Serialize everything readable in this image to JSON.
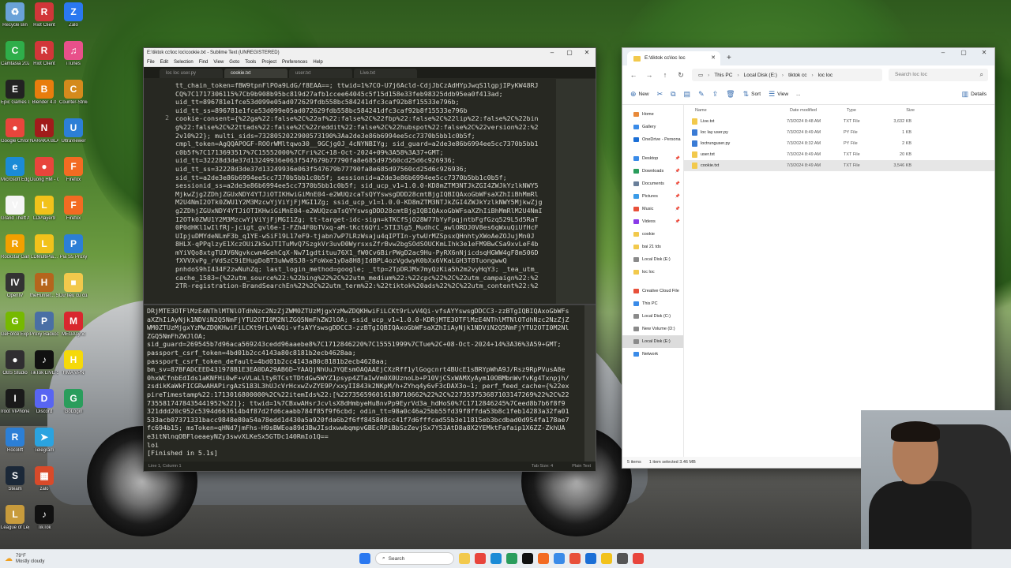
{
  "desktop_icons": [
    {
      "label": "Recycle Bin",
      "color": "#6aa2d8",
      "glyph": "♻"
    },
    {
      "label": "Riot Client",
      "color": "#d13639",
      "glyph": "R"
    },
    {
      "label": "Zalo",
      "color": "#2a78f0",
      "glyph": "Z"
    },
    {
      "label": "Camtasia 2021",
      "color": "#2fae4a",
      "glyph": "C"
    },
    {
      "label": "Riot Client",
      "color": "#d13639",
      "glyph": "R"
    },
    {
      "label": "iTunes",
      "color": "#e8508a",
      "glyph": "♫"
    },
    {
      "label": "Epic Games Launcher",
      "color": "#222222",
      "glyph": "E"
    },
    {
      "label": "Blender 4.0",
      "color": "#e87d0d",
      "glyph": "B"
    },
    {
      "label": "Counter-Strike 2",
      "color": "#d48a1c",
      "glyph": "C"
    },
    {
      "label": "Google Chrome",
      "color": "#e8453c",
      "glyph": "●"
    },
    {
      "label": "NARAKA BLADEPOINT",
      "color": "#a11b1b",
      "glyph": "N"
    },
    {
      "label": "UltraViewer",
      "color": "#2c7fd6",
      "glyph": "U"
    },
    {
      "label": "Microsoft Edge",
      "color": "#1b8bd6",
      "glyph": "e"
    },
    {
      "label": "Duong HM - Chrome",
      "color": "#e8453c",
      "glyph": "●"
    },
    {
      "label": "Firefox",
      "color": "#f36b22",
      "glyph": "F"
    },
    {
      "label": "Grand Theft Auto V",
      "color": "#f5f5f5",
      "glyph": "V"
    },
    {
      "label": "LDPlayer9",
      "color": "#f2c21b",
      "glyph": "L"
    },
    {
      "label": "Firefox",
      "color": "#f36b22",
      "glyph": "F"
    },
    {
      "label": "Rockstar Games ...",
      "color": "#f2a000",
      "glyph": "R"
    },
    {
      "label": "LDMultiPla...",
      "color": "#f2c21b",
      "glyph": "L"
    },
    {
      "label": "Pia S5 Proxy",
      "color": "#2c7fd6",
      "glyph": "P"
    },
    {
      "label": "OpenIV",
      "color": "#333333",
      "glyph": "IV"
    },
    {
      "label": "theHunter... Shortcut",
      "color": "#b5651d",
      "glyph": "H"
    },
    {
      "label": "Dữ liệu cũ của Firefox",
      "color": "#f2c94c",
      "glyph": "■"
    },
    {
      "label": "GeForce Experience",
      "color": "#76b900",
      "glyph": "G"
    },
    {
      "label": "Proxy Backconne...",
      "color": "#4a6fa5",
      "glyph": "P"
    },
    {
      "label": "MEGAsync",
      "color": "#d9272e",
      "glyph": "M"
    },
    {
      "label": "OBS Studio",
      "color": "#302e31",
      "glyph": "●"
    },
    {
      "label": "TikTok LIVE Studio",
      "color": "#111111",
      "glyph": "♪"
    },
    {
      "label": "HMA VPN",
      "color": "#f5d90a",
      "glyph": "H"
    },
    {
      "label": "Iroot VIPhone",
      "color": "#1a1a1a",
      "glyph": "I"
    },
    {
      "label": "Discord",
      "color": "#5865f2",
      "glyph": "D"
    },
    {
      "label": "GoLogin",
      "color": "#2a9d5c",
      "glyph": "G"
    },
    {
      "label": "Rocolift",
      "color": "#2c7fd6",
      "glyph": "R"
    },
    {
      "label": "Telegram",
      "color": "#2aa3e0",
      "glyph": "➤"
    },
    {
      "label": "",
      "color": "",
      "glyph": ""
    },
    {
      "label": "Steam",
      "color": "#1b2838",
      "glyph": "S"
    },
    {
      "label": "zalo",
      "color": "#d84a2a",
      "glyph": "▦"
    },
    {
      "label": "",
      "color": "",
      "glyph": ""
    },
    {
      "label": "League of Legends",
      "color": "#c89b3c",
      "glyph": "L"
    },
    {
      "label": "TikTok",
      "color": "#111111",
      "glyph": "♪"
    }
  ],
  "sublime": {
    "title": "E:\\tiktok cc\\loc loc\\cookie.txt - Sublime Text (UNREGISTERED)",
    "menu": [
      "File",
      "Edit",
      "Selection",
      "Find",
      "View",
      "Goto",
      "Tools",
      "Project",
      "Preferences",
      "Help"
    ],
    "tabs": [
      {
        "label": "loc loc user.py",
        "active": false
      },
      {
        "label": "cookie.txt",
        "active": true
      },
      {
        "label": "user.txt",
        "active": false
      },
      {
        "label": "Live.txt",
        "active": false
      }
    ],
    "gutter": [
      "",
      "",
      "",
      "",
      "2",
      "",
      "",
      "",
      "",
      "",
      "",
      "",
      "",
      "",
      "",
      "",
      "",
      "",
      "",
      "",
      "",
      "",
      "",
      "",
      "",
      "",
      ""
    ],
    "code_lines": [
      "tt_chain_token=fBW9tpnFlPOa9LdG/f8EAA==; ttwid=1%7CO-U7j6Acld-CdjJbCzAdHYpJwqS1lgpjIPyKW48RJ",
      "CQ%7C1717306115%7Cb9b908b95bc819d27afb1ccee64045c5f15d158e33feb98325ddb95ea0f413ad;",
      "uid_tt=896781e1fce53d099e05ad072629fdb558bc584241dfc3caf92b8f15533e796b;",
      "uid_tt_ss=896781e1fce53d099e05ad072629fdb558bc584241dfc3caf92b8f15533e796b",
      "cookie-consent={%22ga%22:false%2C%22af%22:false%2C%22fbp%22:false%2C%22lip%22:false%2C%22bin",
      "g%22:false%2C%22ttads%22:false%2C%22reddit%22:false%2C%22hubspot%22:false%2C%22version%22:%2",
      "2v10%22}; multi_sids=7328052022900573190%3Aa2de3e86b6994ee5cc7370b5bb1c0b5f;",
      "cmpl_token=AgQQAPOGF-ROOrWMltqwo30__9GCjg0J_4cNYNBIYg; sid_guard=a2de3e86b6994ee5cc7370b5bb1",
      "c0b5f%7C1713693517%7C15552000%7CFri%2C+18-Oct-2024+09%3A58%3A37+GMT;",
      "uid_tt=32228d3de37d13249936e063f547679b77790fa8e685d97560cd25d6c926936;",
      "uid_tt_ss=32228d3de37d13249936e063f547679b77790fa8e685d97560cd25d6c926936;",
      "sid_tt=a2de3e86b6994ee5cc7370b5bb1c0b5f; sessionid=a2de3e86b6994ee5cc7370b5bb1c0b5f;",
      "sessionid_ss=a2de3e86b6994ee5cc7370b5bb1c0b5f; sid_ucp_v1=1.0.0-KD8mZTM3NTJkZGI4ZWJkYzlkNWY5",
      "MjkwZjg2ZDhjZGUxNDY4YTJiOTIKHwiGiMnE04-e2WUQzcaTsQYYswsgDDD28cmtBjgIQBIQAxoGbWFsaXZhIiBhMmRl",
      "M2U4NmI2OTk0ZWU1Y2M3MzcwYjViYjFjMGI1Zg; ssid_ucp_v1=1.0.0-KD8mZTM3NTJkZGI4ZWJkYzlkNWY5MjkwZjg",
      "g2ZDhjZGUxNDY4YTJiOTIKHwiGiMnE04-e2WUQzcaTsQYYswsgDDD28cmtBjgIQBIQAxoGbWFsaXZhIiBhMmRlM2U4NmI",
      "I2OTk0ZWU1Y2M3MzcwYjViYjFjMGI1Zg; tt-target-idc-sign=kTKCfSjO28W77bYyFpqjntbFgfGzq529L5d5RaT",
      "0P0dHKl1wIlfRj-jcigt_gvl6e-I-FZh4F0bTVxq-aM-tKct6QYi-5TI3lg5_MudhcC_awlORDJ0V8es6qWxuQiUfHcF",
      "UIpjuDMYdeNLmF3b_q1YE-wSiF19L17eF9-tjabn7wP7LRzWsaju4qIPTIn-ytwUrMZSpsxQHnhtyXWoAeZOJujMn0J",
      "8HLX-qPPqlzyE1XczOUiZkSwJTITuMvQ7SzgkVr3uvD0WyrsxsZfrBvw2bgSOdSOUCKmLIhk3e1eFM9BwCSa9xvLeF4b",
      "mYiVQo8xtgTUJV6Ngvkcwm4GehCqX-Nw71gdtituu76X1_fW0Cv6BirPWgD2ac9Hu-PyRX6nNjicdsqHGWW4gF8m506D",
      "fXVVXvPg_rVdSzC9iEHugDoBT3uWw8SJ8-sFoWxe1yDa8H8jIdBPL4ozVgdwyK0bXx6VKaLGH3T8TuongwwQ",
      "pnhdoS9hI434F2zwNuhZq; last_login_method=google; _ttp=2TpDRJMx7myQzKia5h2m2vyHqY3; _tea_utm_",
      "cache_1583={%22utm_source%22:%22bing%22%2C%22utm_medium%22:%22cpc%22%2C%22utm_campaign%22:%2",
      "2TR-registration-BrandSearchEn%22%2C%22utm_term%22:%22tiktok%20ads%22%2C%22utm_content%22:%2"
    ],
    "output_lines": [
      "DRjMTE3OTFlMzE4NThlMTNlOTdhNzc2NzZjZWM0ZTUzMjgxYzMwZDQKHwiFiLCKt9rLvV4Qi-vfsAYYswsgDDCC3-zzBTgIQBIQAxoGbWFs",
      "aXZhIiAyNjk1NDViN2Q5NmFjYTU2OTI0M2NlZGQ5NmFhZWJlOA; ssid_ucp_v1=1.0.0-KDRjMTE3OTFlMzE4NThlMTNlOTdhNzc2NzZjZ",
      "WM0ZTUzMjgxYzMwZDQKHwiFiLCKt9rLvV4Qi-vfsAYYswsgDDCC3-zzBTgIQBIQAxoGbWFsaXZhIiAyNjk1NDViN2Q5NmFjYTU2OTI0M2Nl",
      "ZGQ5NmFhZWJlOA;",
      "sid_guard=269545b7d96aca569243cedd96aaebe8%7C1712846220%7C15551999%7CTue%2C+08-Oct-2024+14%3A36%3A59+GMT;",
      "passport_csrf_token=4bd01b2cc4143a80c8181b2ecb4628aa;",
      "passport_csrf_token_default=4bd01b2cc4143a80c8181b2ecb4628aa;",
      "bm_sv=87BFADCEED431978B1E3EA0DA29AB6D~YAAQjNhUuJYQEsmOAQAAEjCXzRff1ylGogcnrt4BUcE1sBRYpWhA9J/Rsz9RpPVusA8e",
      "0hxWCfnbEdIds1aKNFHi0wF+vVLaLltyRTCstTDtdGw5WYZ1psyp4ZTaIwVm0X0UznoLb+P10VjCSxWAMXyAym10OBMbnWvfvKg4Txnpjh/",
      "zsdikKaWkFICGRwAHAPirgAzS183L3hUJcVrHcxwZvZYE9P/xxyII843k2NKpM/h+ZYhq4y6vF3cDAX3o~1; perf_feed_cache={%22ex",
      "pireTimestamp%22:1713016800000%2C%22itemIds%22:[%227356596016180710662%22%2C%227353753687103147269%22%2C%22",
      "7355817478435441952%22]}; ttwid=1%7CBxwAHsrJcvlsX8dHmbyeHuBnvPp9EyrVd3a_hdHoS0%7C1712846245%7Ceed8b7b6f8f9",
      "321ddd20c952c5394d663614b4f87d2fd6caabb784f85f9f6cbd; odin_tt=98a0c46a25bb55fd39f8ffda53b8c1feb14283a32fa01",
      "533acb07371331bacc9848e80a54a78edd1d430a5a920fda6b2f6ff8458d8cc41f7d6fffcad55b3e11815eb3bcdbad0d954fa178ae7",
      "fc694b15; msToken=qHNd7jmFhs-H9sBWEoa89d3BwJIsdxwwbqmpvGBEcRPiBbSzZevjSx7Y53AtD8a8X2YEMktFafaip1X6ZZ-ZkhUA",
      "e3itNlnqOBFloeaeyNZy3swvXLKeSx5GTDc140RmIo1Q==",
      "loi",
      "[Finished in 5.1s]"
    ],
    "status_left": "Line 1, Column 1",
    "status_tab": "Tab Size: 4",
    "status_syntax": "Plain Text"
  },
  "explorer": {
    "tab_title": "E:\\tiktok cc\\loc loc",
    "address": [
      "This PC",
      "Local Disk (E:)",
      "tiktok cc",
      "loc loc"
    ],
    "search_placeholder": "Search loc loc",
    "toolbar": {
      "new": "New",
      "sort": "Sort",
      "view": "View",
      "more": "...",
      "details": "Details"
    },
    "nav_items": [
      {
        "label": "Home",
        "color": "#e88a3a",
        "selected": false,
        "pin": false
      },
      {
        "label": "Gallery",
        "color": "#3a8be8",
        "selected": false,
        "pin": false
      },
      {
        "label": "OneDrive - Persona",
        "color": "#1b6fd6",
        "selected": false,
        "pin": false
      },
      {
        "label": "",
        "color": "",
        "selected": false,
        "pin": false
      },
      {
        "label": "Desktop",
        "color": "#3a8be8",
        "selected": false,
        "pin": true
      },
      {
        "label": "Downloads",
        "color": "#2a9d5c",
        "selected": false,
        "pin": true
      },
      {
        "label": "Documents",
        "color": "#6a7f9a",
        "selected": false,
        "pin": true
      },
      {
        "label": "Pictures",
        "color": "#3a9be8",
        "selected": false,
        "pin": true
      },
      {
        "label": "Music",
        "color": "#e8503a",
        "selected": false,
        "pin": true
      },
      {
        "label": "Videos",
        "color": "#8a3ae8",
        "selected": false,
        "pin": true
      },
      {
        "label": "cookie",
        "color": "#f2c94c",
        "selected": false,
        "pin": false
      },
      {
        "label": "bai 21 tds",
        "color": "#f2c94c",
        "selected": false,
        "pin": false
      },
      {
        "label": "Local Disk (E:)",
        "color": "#8a8a8a",
        "selected": false,
        "pin": false
      },
      {
        "label": "loc loc",
        "color": "#f2c94c",
        "selected": false,
        "pin": false
      },
      {
        "label": "",
        "color": "",
        "selected": false,
        "pin": false
      },
      {
        "label": "Creative Cloud File",
        "color": "#e8503a",
        "selected": false,
        "pin": false
      },
      {
        "label": "This PC",
        "color": "#3a8be8",
        "selected": false,
        "pin": false
      },
      {
        "label": "Local Disk (C:)",
        "color": "#8a8a8a",
        "selected": false,
        "pin": false
      },
      {
        "label": "New Volume (D:)",
        "color": "#8a8a8a",
        "selected": false,
        "pin": false
      },
      {
        "label": "Local Disk (E:)",
        "color": "#8a8a8a",
        "selected": true,
        "pin": false
      },
      {
        "label": "Network",
        "color": "#3a8be8",
        "selected": false,
        "pin": false
      }
    ],
    "columns": [
      "Name",
      "Date modified",
      "Type",
      "Size"
    ],
    "files": [
      {
        "name": "Live.txt",
        "date": "7/3/2024 8:48 AM",
        "type": "TXT File",
        "size": "3,632 KB",
        "color": "#f2c94c",
        "selected": false
      },
      {
        "name": "loc lay user.py",
        "date": "7/3/2024 8:49 AM",
        "type": "PY File",
        "size": "1 KB",
        "color": "#3a7bd5",
        "selected": false
      },
      {
        "name": "loctrunguser.py",
        "date": "7/3/2024 8:32 AM",
        "type": "PY File",
        "size": "2 KB",
        "color": "#3a7bd5",
        "selected": false
      },
      {
        "name": "user.txt",
        "date": "7/3/2024 8:49 AM",
        "type": "TXT File",
        "size": "20 KB",
        "color": "#f2c94c",
        "selected": false
      },
      {
        "name": "cookie.txt",
        "date": "7/3/2024 8:49 AM",
        "type": "TXT File",
        "size": "3,546 KB",
        "color": "#f2c94c",
        "selected": true
      }
    ],
    "status_count": "5 items",
    "status_selected": "1 item selected  3.46 MB"
  },
  "taskbar": {
    "weather_temp": "79°F",
    "weather_text": "Mostly cloudy",
    "search_label": "Search",
    "icon_colors": [
      "#f2c94c",
      "#e8453c",
      "#1b8bd6",
      "#2a9d5c",
      "#111111",
      "#f36b22",
      "#3a8be8",
      "#e8503a",
      "#1b6fd6",
      "#f2c21b",
      "#555555",
      "#e8453c"
    ]
  }
}
